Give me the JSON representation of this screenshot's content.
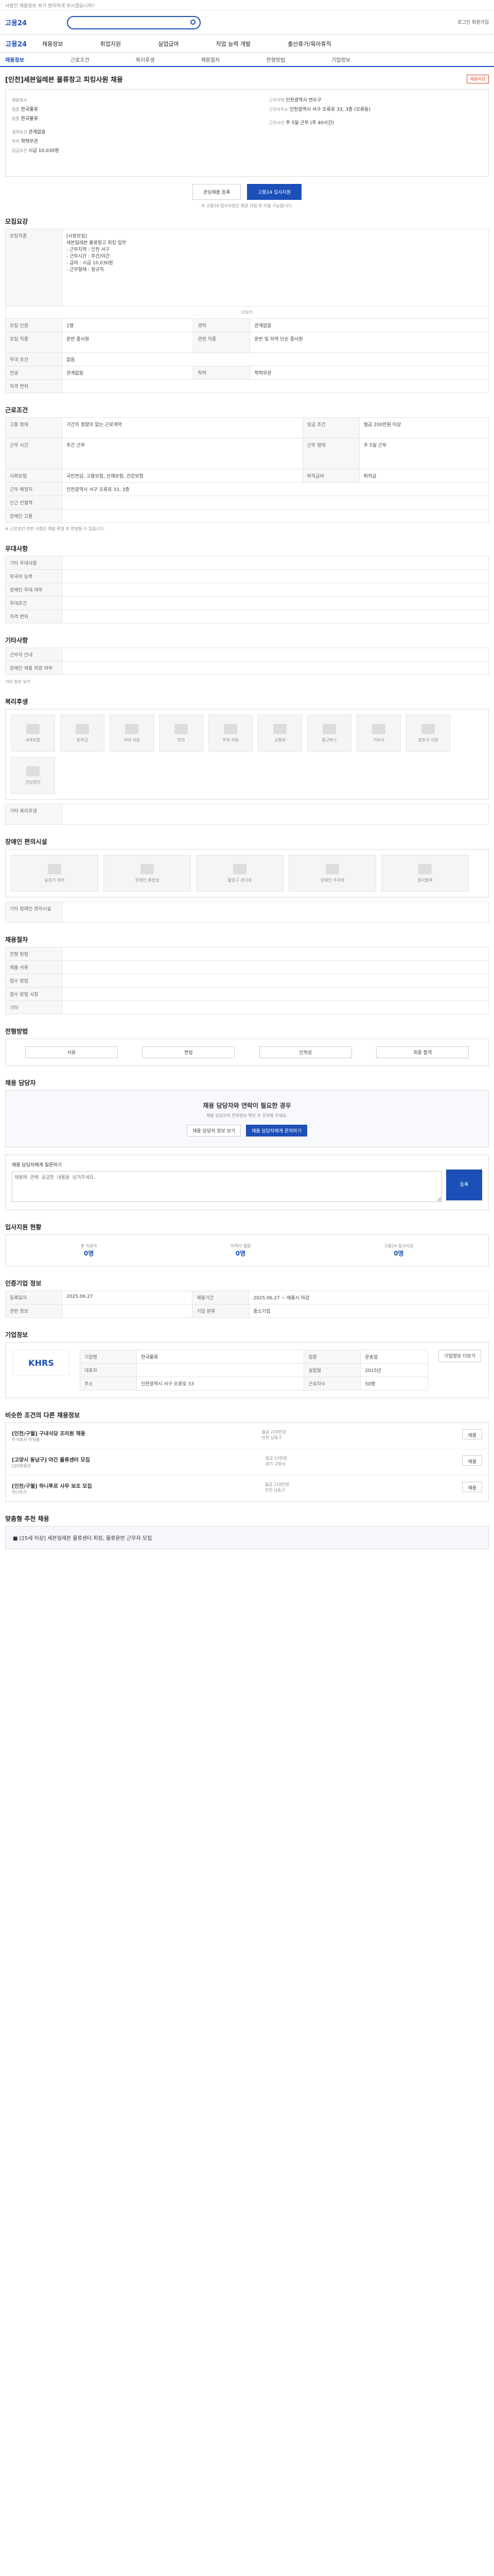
{
  "topbar": {
    "notice": "사람인 채용정보 보기 편리하게 보시겠습니까?"
  },
  "header": {
    "logo": "고용24",
    "right": "로그인 회원가입"
  },
  "gnb": {
    "logo": "고용24",
    "items": [
      "채용정보",
      "취업지원",
      "실업급여",
      "직업 능력 개발",
      "출산휴가/육아휴직"
    ]
  },
  "subtabs": [
    "채용정보",
    "근로조건",
    "복리후생",
    "채용절차",
    "전형방법",
    "기업정보"
  ],
  "job": {
    "title": "[인천]세븐일레븐 물류창고 피킹사원 채용",
    "badge": "채용마감",
    "company_label": "채용회사",
    "company": "한국물류",
    "industry_label": "업종",
    "industry": "한국물류",
    "place_label": "근무지역",
    "place": "인천광역시 연수구",
    "workplace_label": "근무지주소",
    "workplace": "인천광역시 서구 오류로 33, 3층 (오류동)",
    "career_label": "경력조건",
    "career": "관계없음",
    "edu_label": "학력",
    "edu": "학력무관",
    "wage_label": "임금조건",
    "wage": "시급 10,030원",
    "hours_label": "근무시간",
    "hours": "주 5일 근무 (주 40시간)",
    "save_btn": "관심채용 등록",
    "apply_btn": "고용24 입사지원",
    "apply_note": "※ 고용24 입사지원은 회원 가입 후 이용 가능합니다."
  },
  "detail": {
    "title": "모집요강",
    "job_label": "모집직종",
    "job_text": "[사원모집]\n세븐일레븐 물류창고 피킹 업무\n- 근무지역 : 인천 서구\n- 근무시간 : 주간/야간\n- 급여 : 시급 10,030원\n- 근무형태 : 정규직",
    "more": "더보기",
    "rows": [
      [
        "모집 인원",
        "1명",
        "경력",
        "관계없음"
      ],
      [
        "모집 직종",
        "운반 종사원",
        "관련 직종",
        "운반 및 하역 단순 종사원"
      ],
      [
        "우대 조건",
        "없음",
        "",
        ""
      ],
      [
        "전공",
        "관계없음",
        "학력",
        "학력무관"
      ],
      [
        "자격 면허",
        "",
        "",
        ""
      ]
    ]
  },
  "cond": {
    "title": "근로조건",
    "rows": [
      [
        "고용 형태",
        "기간의 정함이 없는 근로계약",
        "임금 조건",
        "월급 200만원 이상"
      ],
      [
        "근무 시간",
        "주간 근무",
        "근무 형태",
        "주 5일 근무"
      ],
      [
        "사회보험",
        "국민연금, 고용보험, 산재보험, 건강보험",
        "퇴직급여",
        "퇴직금"
      ],
      [
        "근무 예정지",
        "인천광역시 서구 오류로 33, 3층",
        "",
        ""
      ],
      [
        "인근 전철역",
        "",
        "",
        ""
      ],
      [
        "장애인 고용",
        "",
        "",
        ""
      ]
    ],
    "note": "※ 근로조건 관련 사항은 채용 확정 후 변경될 수 있습니다."
  },
  "pref": {
    "title": "우대사항",
    "rows": [
      "기타 우대사항",
      "외국어 능력",
      "장애인 우대 여부",
      "우대조건",
      "자격 면허"
    ]
  },
  "etc": {
    "title": "기타사항",
    "rows": [
      "근무지 안내",
      "장애인 채용 희망 여부"
    ],
    "more": "기타 정보 보기"
  },
  "welfare": {
    "title": "복리후생",
    "items": [
      "4대보험",
      "퇴직금",
      "식대 지원",
      "연차",
      "주차 지원",
      "교통비",
      "통근버스",
      "기숙사",
      "경조사 지원",
      "건강검진"
    ],
    "etc_label": "기타 복리후생"
  },
  "access": {
    "title": "장애인 편의시설",
    "items": [
      "승강기 여부",
      "장애인 화장실",
      "출입구 경사로",
      "장애인 주차장",
      "점자블록"
    ],
    "label": "기타 장애인 편의시설"
  },
  "process": {
    "title": "채용절차",
    "rows": [
      "전형 방법",
      "제출 서류",
      "접수 방법",
      "접수 방법 사항",
      "기타"
    ]
  },
  "method": {
    "title": "전형방법",
    "items": [
      "서류",
      "면접",
      "인적성",
      "최종 합격"
    ]
  },
  "contact": {
    "title": "채용 담당자",
    "box_title": "채용 담당자와 연락이 필요한 경우",
    "box_text": "채용 담당자의 연락정보 확인 후 문의해 주세요.",
    "btn1": "채용 담당자 정보 보기",
    "btn2": "채용 담당자에게 문의하기"
  },
  "inquiry": {
    "title": "채용 담당자에게 질문하기",
    "placeholder": "채용에 관해 궁금한 내용을 남겨주세요.",
    "btn": "등록"
  },
  "apply_stats": {
    "title": "입사지원 현황",
    "items": [
      "총 지원자",
      "이력서 열람",
      "고용24 입사지원"
    ],
    "values": [
      "0명",
      "0명",
      "0명"
    ]
  },
  "info": {
    "title": "인증기업 정보",
    "rows": [
      [
        "등록일자",
        "2025.06.27",
        "채용기간",
        "2025.06.27 ~ 채용시 마감"
      ],
      [
        "관련 정보",
        "",
        "기업 분류",
        "중소기업"
      ]
    ]
  },
  "company": {
    "title": "기업정보",
    "logo": "KHRS",
    "rows": [
      [
        "기업명",
        "한국물류",
        "업종",
        "운송업"
      ],
      [
        "대표자",
        "",
        "설립일",
        "2015년"
      ],
      [
        "주소",
        "인천광역시 서구 오류로 33",
        "근로자수",
        "50명"
      ]
    ],
    "btn": "기업정보 더보기"
  },
  "similar": {
    "title": "비슷한 조건의 다른 채용정보",
    "items": [
      {
        "title": "[인천/구월] 구내식당 조리원 채용",
        "company": "주식회사 아워홈",
        "wage": "월급 220만원",
        "loc": "인천 남동구",
        "badge": "채용"
      },
      {
        "title": "[고양시 동남구] 야간 물류센터 모집",
        "company": "CJ대한통운",
        "wage": "일급 13만원",
        "loc": "경기 고양시",
        "badge": "채용"
      },
      {
        "title": "[인천/구월] 하니투르 사무 보조 모집",
        "company": "하니투르",
        "wage": "월급 210만원",
        "loc": "인천 남동구",
        "badge": "채용"
      }
    ]
  },
  "banner": {
    "title": "맞춤형 추천 채용",
    "text": "■ [25세 이상] 세븐일레븐 물류센터 피킹, 물류운반 근무자 모집"
  }
}
